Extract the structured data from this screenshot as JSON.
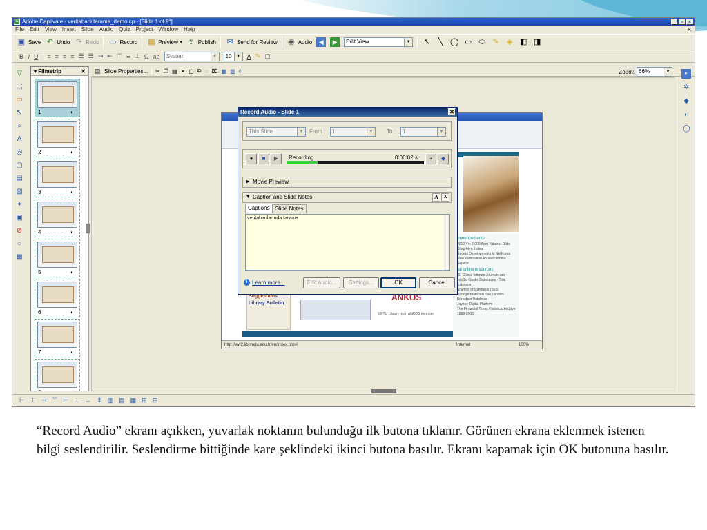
{
  "window": {
    "title": "Adobe Captivate - veritabani tarama_demo.cp - [Slide 1 of 9*]",
    "controls": [
      "_",
      "▫",
      "×"
    ]
  },
  "menu": [
    "File",
    "Edit",
    "View",
    "Insert",
    "Slide",
    "Audio",
    "Quiz",
    "Project",
    "Window",
    "Help"
  ],
  "toolbar": {
    "save": "Save",
    "undo": "Undo",
    "redo": "Redo",
    "record": "Record",
    "preview": "Preview",
    "publish": "Publish",
    "send_for_review": "Send for Review",
    "audio": "Audio",
    "edit_view": "Edit View",
    "font": "System",
    "font_size": "10"
  },
  "filmstrip": {
    "label": "Filmstrip",
    "slides": [
      "1",
      "2",
      "3",
      "4",
      "5",
      "6",
      "7",
      "8"
    ]
  },
  "stage": {
    "slide_properties": "Slide Properties...",
    "zoom_label": "Zoom:",
    "zoom_value": "66%"
  },
  "dialog": {
    "title": "Record Audio - Slide 1",
    "range_value": "This Slide",
    "from_label": "From :",
    "from_value": "1",
    "to_label": "To :",
    "to_value": "1",
    "recording_label": "Recording",
    "recording_time": "0:00:02 s",
    "recording_level": 0.22,
    "movie_preview": "Movie Preview",
    "caption_notes": "Caption and Slide Notes",
    "tab_captions": "Captions",
    "tab_slide_notes": "Slide Notes",
    "notes_text": "veritabanlarında tarama",
    "learn_more": "Learn more...",
    "edit_audio": "Edit Audio...",
    "settings": "Settings...",
    "ok": "OK",
    "cancel": "Cancel"
  },
  "browser": {
    "announcements": "announcements",
    "ann_items": [
      "2010 Yılı 2.000 Adet Yabancı Dilde Kitap Alım İhalesi",
      "Recent Developments in NetNoma",
      "New Publication Announcement Service"
    ],
    "trial": "trial online resources",
    "trial_items": [
      "ISI Global Inforum Journals and InfoSci-Books Databases - Trial Extension",
      "Science of Synthesis (SoS)",
      "SpringerMaterials The Landolt-Börnstein Database",
      "Jaypee Digital Platform",
      "The Financial Times Historical Archive 1888-2006"
    ],
    "book_suggestions": "Book Suggestions",
    "library_bulletin": "Library Bulletin",
    "ankos": "ANKOS",
    "ankos_caption": "METU Library is an ANKOS member.",
    "status_url": "http://ww2.lib.metu.edu.tr/en/index.php#",
    "status_zone": "Internet",
    "status_zoom": "100%"
  },
  "caption": "“Record Audio” ekranı açıkken, yuvarlak noktanın bulunduğu ilk butona tıklanır. Görünen ekrana eklenmek istenen bilgi seslendirilir. Seslendirme bittiğinde  kare şeklindeki ikinci butona basılır. Ekranı kapamak için OK butonuna basılır."
}
